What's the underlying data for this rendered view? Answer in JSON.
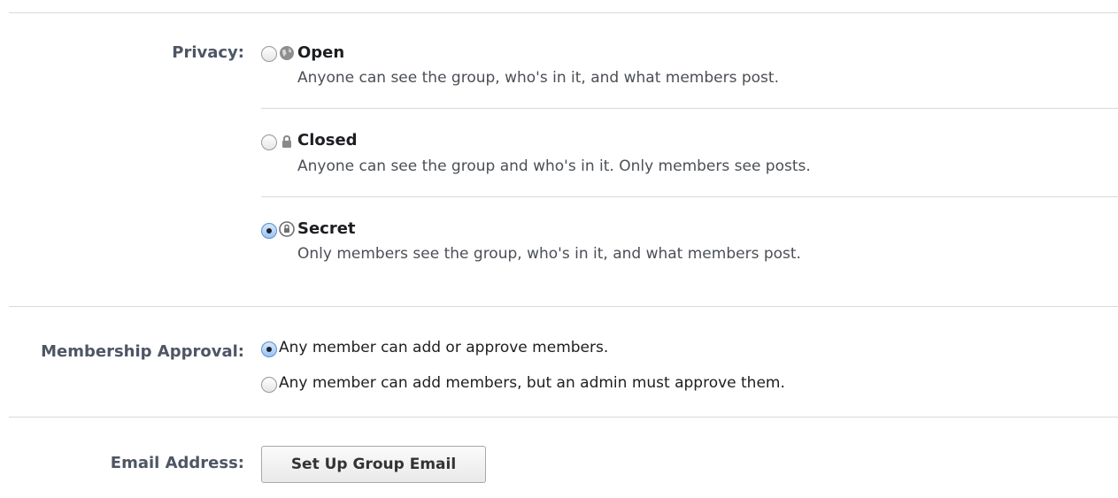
{
  "privacy": {
    "label": "Privacy:",
    "selected": "Secret",
    "options": [
      {
        "title": "Open",
        "description": "Anyone can see the group, who's in it, and what members post.",
        "icon": "globe-icon",
        "checked": false
      },
      {
        "title": "Closed",
        "description": "Anyone can see the group and who's in it. Only members see posts.",
        "icon": "lock-icon",
        "checked": false
      },
      {
        "title": "Secret",
        "description": "Only members see the group, who's in it, and what members post.",
        "icon": "secret-lock-icon",
        "checked": true
      }
    ]
  },
  "membership_approval": {
    "label": "Membership Approval:",
    "options": [
      {
        "text": "Any member can add or approve members.",
        "checked": true
      },
      {
        "text": "Any member can add members, but an admin must approve them.",
        "checked": false
      }
    ]
  },
  "email": {
    "label": "Email Address:",
    "button_label": "Set Up Group Email"
  },
  "colors": {
    "label": "#4e5665",
    "divider": "#d9d9d9",
    "radio_checked": "#9cc3f0"
  }
}
